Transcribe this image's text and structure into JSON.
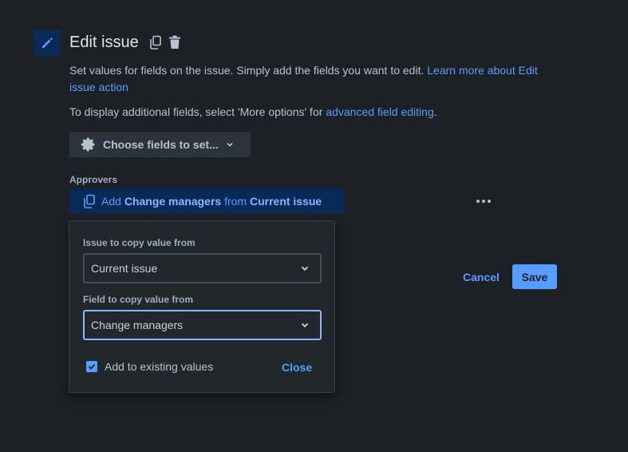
{
  "header": {
    "title": "Edit issue",
    "icon": "pencil-icon",
    "actions": [
      "copy-icon",
      "trash-icon"
    ]
  },
  "description": {
    "text": "Set values for fields on the issue. Simply add the fields you want to edit.",
    "link": "Learn more about Edit issue action",
    "text2": "To display additional fields, select 'More options' for",
    "link2": "advanced field editing",
    "text2_end": "."
  },
  "choose_fields": {
    "label": "Choose fields to set..."
  },
  "approvers": {
    "label": "Approvers",
    "pill_prefix": "Add",
    "pill_field": "Change managers",
    "pill_mid": "from",
    "pill_source": "Current issue"
  },
  "popup": {
    "issue_label": "Issue to copy value from",
    "issue_value": "Current issue",
    "field_label": "Field to copy value from",
    "field_value": "Change managers",
    "checkbox_label": "Add to existing values",
    "checkbox_checked": true,
    "close_label": "Close"
  },
  "buttons": {
    "cancel": "Cancel",
    "save": "Save"
  },
  "colors": {
    "accent": "#579dff",
    "background": "#1d2125",
    "popup_bg": "#22272b"
  }
}
